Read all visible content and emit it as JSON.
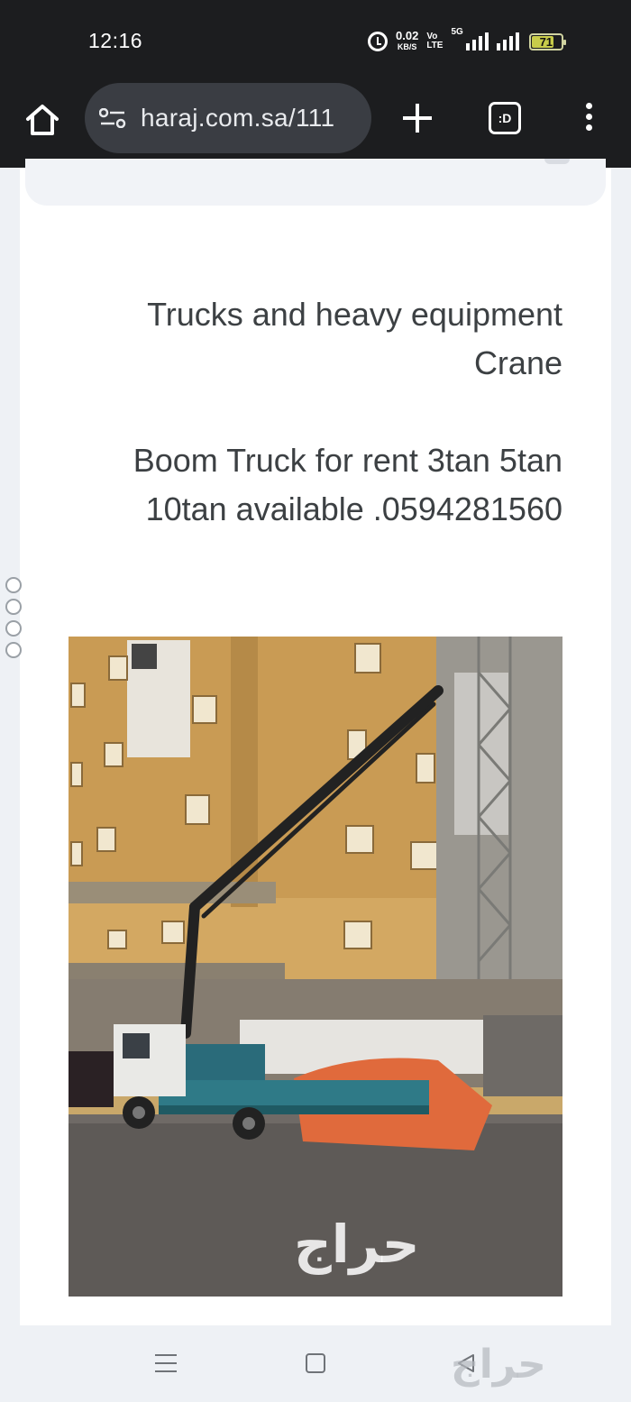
{
  "status_bar": {
    "time": "12:16",
    "net_speed_value": "0.02",
    "net_speed_unit": "KB/S",
    "volte_top": "Vo",
    "volte_bottom": "LTE",
    "network_label": "5G",
    "battery_level": "71",
    "battery_fraction": 0.71
  },
  "toolbar": {
    "home_icon": "home-icon",
    "site_settings_icon": "tune-icon",
    "url": "haraj.com.sa/111",
    "new_tab_icon": "plus-icon",
    "tabs_label": ":D",
    "menu_icon": "more-vert-icon"
  },
  "post": {
    "category_line1": "Trucks and heavy equipment",
    "category_line2": "Crane",
    "description_line1": "Boom Truck for rent 3tan 5tan",
    "description_line2": "10tan available .0594281560",
    "image_watermark": "حراج"
  },
  "navbar": {
    "recents_icon": "recents-icon",
    "home_icon": "home-square-icon",
    "back_icon": "back-triangle-icon",
    "watermark": "حراج"
  },
  "colors": {
    "status_bg": "#1c1d1f",
    "pill_bg": "#3a3d43",
    "page_bg": "#eef1f5",
    "text": "#3c4043",
    "battery": "#c8cc4a"
  }
}
